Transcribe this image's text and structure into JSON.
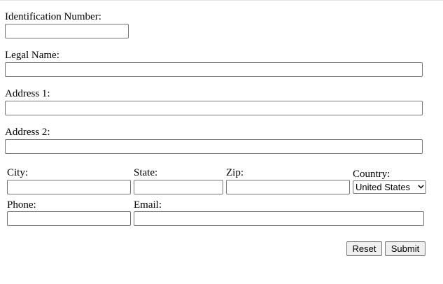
{
  "form": {
    "id_number": {
      "label": "Identification Number:",
      "value": ""
    },
    "legal_name": {
      "label": "Legal Name:",
      "value": ""
    },
    "address1": {
      "label": "Address 1:",
      "value": ""
    },
    "address2": {
      "label": "Address 2:",
      "value": ""
    },
    "city": {
      "label": "City:",
      "value": ""
    },
    "state": {
      "label": "State:",
      "value": ""
    },
    "zip": {
      "label": "Zip:",
      "value": ""
    },
    "country": {
      "label": "Country:",
      "selected": "United States"
    },
    "phone": {
      "label": "Phone:",
      "value": ""
    },
    "email": {
      "label": "Email:",
      "value": ""
    }
  },
  "actions": {
    "reset_label": "Reset",
    "submit_label": "Submit"
  },
  "icons": {
    "country_dropdown": "chevron-down-icon"
  }
}
